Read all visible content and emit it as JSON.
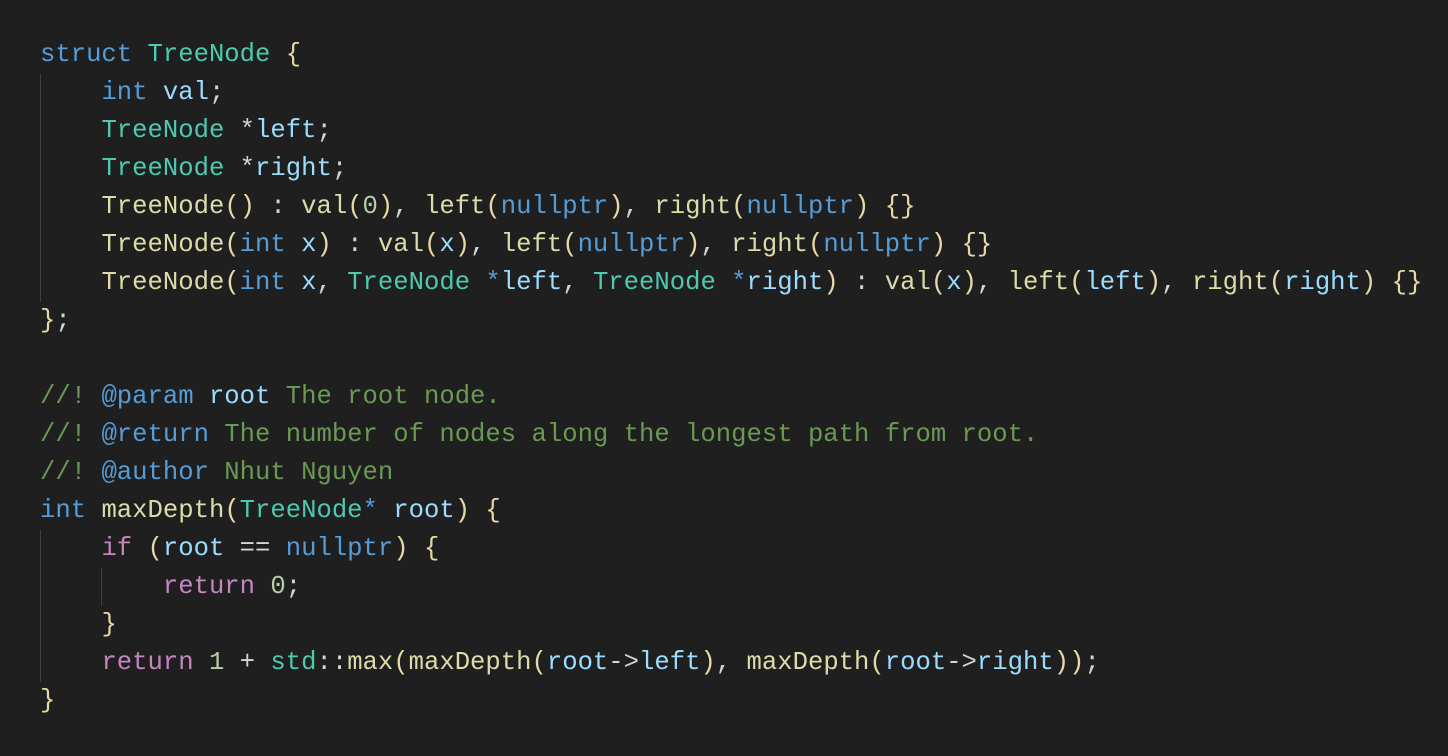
{
  "editor": {
    "theme_colors": {
      "background": "#1f1f1f",
      "keyword": "#569cd6",
      "type": "#4ec9b0",
      "variable": "#9cdcfe",
      "function": "#dcdcaa",
      "comment": "#6a9955",
      "control": "#c586c0",
      "number": "#b5cea8"
    },
    "lines": [
      {
        "indent": 0,
        "tokens": [
          [
            "struct",
            "kw"
          ],
          [
            " ",
            "pu"
          ],
          [
            "TreeNode",
            "ty"
          ],
          [
            " ",
            "pu"
          ],
          [
            "{",
            "br"
          ]
        ]
      },
      {
        "indent": 1,
        "tokens": [
          [
            "int",
            "kw"
          ],
          [
            " ",
            "pu"
          ],
          [
            "val",
            "va"
          ],
          [
            ";",
            "pu"
          ]
        ]
      },
      {
        "indent": 1,
        "tokens": [
          [
            "TreeNode",
            "ty"
          ],
          [
            " *",
            "pu"
          ],
          [
            "left",
            "va"
          ],
          [
            ";",
            "pu"
          ]
        ]
      },
      {
        "indent": 1,
        "tokens": [
          [
            "TreeNode",
            "ty"
          ],
          [
            " *",
            "pu"
          ],
          [
            "right",
            "va"
          ],
          [
            ";",
            "pu"
          ]
        ]
      },
      {
        "indent": 1,
        "tokens": [
          [
            "TreeNode",
            "fn"
          ],
          [
            "()",
            "br"
          ],
          [
            " : ",
            "pu"
          ],
          [
            "val",
            "fn"
          ],
          [
            "(",
            "br"
          ],
          [
            "0",
            "nu"
          ],
          [
            ")",
            "br"
          ],
          [
            ", ",
            "pu"
          ],
          [
            "left",
            "fn"
          ],
          [
            "(",
            "br"
          ],
          [
            "nullptr",
            "kw"
          ],
          [
            ")",
            "br"
          ],
          [
            ", ",
            "pu"
          ],
          [
            "right",
            "fn"
          ],
          [
            "(",
            "br"
          ],
          [
            "nullptr",
            "kw"
          ],
          [
            ")",
            "br"
          ],
          [
            " ",
            "pu"
          ],
          [
            "{}",
            "br"
          ]
        ]
      },
      {
        "indent": 1,
        "tokens": [
          [
            "TreeNode",
            "fn"
          ],
          [
            "(",
            "br"
          ],
          [
            "int",
            "kw"
          ],
          [
            " ",
            "pu"
          ],
          [
            "x",
            "va"
          ],
          [
            ")",
            "br"
          ],
          [
            " : ",
            "pu"
          ],
          [
            "val",
            "fn"
          ],
          [
            "(",
            "br"
          ],
          [
            "x",
            "va"
          ],
          [
            ")",
            "br"
          ],
          [
            ", ",
            "pu"
          ],
          [
            "left",
            "fn"
          ],
          [
            "(",
            "br"
          ],
          [
            "nullptr",
            "kw"
          ],
          [
            ")",
            "br"
          ],
          [
            ", ",
            "pu"
          ],
          [
            "right",
            "fn"
          ],
          [
            "(",
            "br"
          ],
          [
            "nullptr",
            "kw"
          ],
          [
            ")",
            "br"
          ],
          [
            " ",
            "pu"
          ],
          [
            "{}",
            "br"
          ]
        ]
      },
      {
        "indent": 1,
        "tokens": [
          [
            "TreeNode",
            "fn"
          ],
          [
            "(",
            "br"
          ],
          [
            "int",
            "kw"
          ],
          [
            " ",
            "pu"
          ],
          [
            "x",
            "va"
          ],
          [
            ", ",
            "pu"
          ],
          [
            "TreeNode",
            "ty"
          ],
          [
            " *",
            "kw"
          ],
          [
            "left",
            "va"
          ],
          [
            ", ",
            "pu"
          ],
          [
            "TreeNode",
            "ty"
          ],
          [
            " *",
            "kw"
          ],
          [
            "right",
            "va"
          ],
          [
            ")",
            "br"
          ],
          [
            " : ",
            "pu"
          ],
          [
            "val",
            "fn"
          ],
          [
            "(",
            "br"
          ],
          [
            "x",
            "va"
          ],
          [
            ")",
            "br"
          ],
          [
            ", ",
            "pu"
          ],
          [
            "left",
            "fn"
          ],
          [
            "(",
            "br"
          ],
          [
            "left",
            "va"
          ],
          [
            ")",
            "br"
          ],
          [
            ", ",
            "pu"
          ],
          [
            "right",
            "fn"
          ],
          [
            "(",
            "br"
          ],
          [
            "right",
            "va"
          ],
          [
            ")",
            "br"
          ],
          [
            " ",
            "pu"
          ],
          [
            "{}",
            "br"
          ]
        ]
      },
      {
        "indent": 0,
        "tokens": [
          [
            "}",
            "br"
          ],
          [
            ";",
            "pu"
          ]
        ]
      },
      {
        "indent": 0,
        "tokens": []
      },
      {
        "indent": 0,
        "tokens": [
          [
            "//! ",
            "cm"
          ],
          [
            "@param",
            "tg"
          ],
          [
            " ",
            "cm"
          ],
          [
            "root",
            "va"
          ],
          [
            " The root node.",
            "cm"
          ]
        ]
      },
      {
        "indent": 0,
        "tokens": [
          [
            "//! ",
            "cm"
          ],
          [
            "@return",
            "tg"
          ],
          [
            " The number of nodes along the longest path from root.",
            "cm"
          ]
        ]
      },
      {
        "indent": 0,
        "tokens": [
          [
            "//! ",
            "cm"
          ],
          [
            "@author",
            "tg"
          ],
          [
            " Nhut Nguyen",
            "cm"
          ]
        ]
      },
      {
        "indent": 0,
        "tokens": [
          [
            "int",
            "kw"
          ],
          [
            " ",
            "pu"
          ],
          [
            "maxDepth",
            "fn"
          ],
          [
            "(",
            "br"
          ],
          [
            "TreeNode",
            "ty"
          ],
          [
            "*",
            "kw"
          ],
          [
            " ",
            "pu"
          ],
          [
            "root",
            "va"
          ],
          [
            ")",
            "br"
          ],
          [
            " ",
            "pu"
          ],
          [
            "{",
            "br"
          ]
        ]
      },
      {
        "indent": 1,
        "tokens": [
          [
            "if",
            "ct"
          ],
          [
            " ",
            "pu"
          ],
          [
            "(",
            "br"
          ],
          [
            "root",
            "va"
          ],
          [
            " == ",
            "pu"
          ],
          [
            "nullptr",
            "kw"
          ],
          [
            ")",
            "br"
          ],
          [
            " ",
            "pu"
          ],
          [
            "{",
            "br"
          ]
        ]
      },
      {
        "indent": 2,
        "tokens": [
          [
            "return",
            "ct"
          ],
          [
            " ",
            "pu"
          ],
          [
            "0",
            "nu"
          ],
          [
            ";",
            "pu"
          ]
        ]
      },
      {
        "indent": 1,
        "tokens": [
          [
            "}",
            "br"
          ]
        ]
      },
      {
        "indent": 1,
        "tokens": [
          [
            "return",
            "ct"
          ],
          [
            " ",
            "pu"
          ],
          [
            "1",
            "nu"
          ],
          [
            " + ",
            "pu"
          ],
          [
            "std",
            "ty"
          ],
          [
            "::",
            "pu"
          ],
          [
            "max",
            "fn"
          ],
          [
            "(",
            "br"
          ],
          [
            "maxDepth",
            "fn"
          ],
          [
            "(",
            "br"
          ],
          [
            "root",
            "va"
          ],
          [
            "->",
            "pu"
          ],
          [
            "left",
            "va"
          ],
          [
            ")",
            "br"
          ],
          [
            ", ",
            "pu"
          ],
          [
            "maxDepth",
            "fn"
          ],
          [
            "(",
            "br"
          ],
          [
            "root",
            "va"
          ],
          [
            "->",
            "pu"
          ],
          [
            "right",
            "va"
          ],
          [
            "))",
            "br"
          ],
          [
            ";",
            "pu"
          ]
        ]
      },
      {
        "indent": 0,
        "tokens": [
          [
            "}",
            "br"
          ]
        ]
      }
    ]
  }
}
